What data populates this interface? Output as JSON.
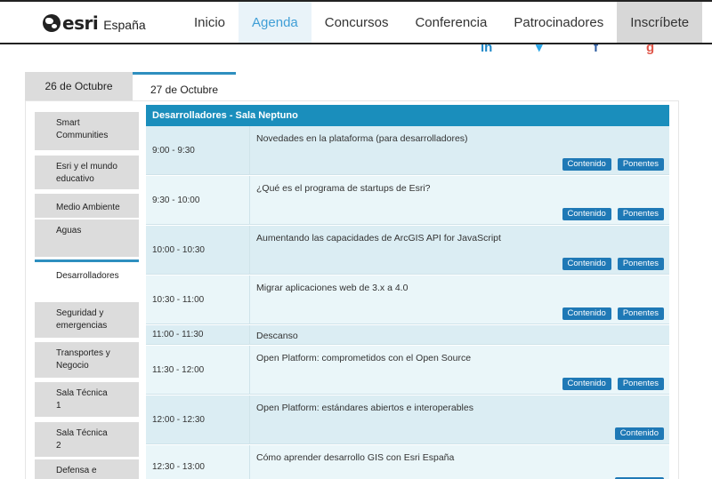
{
  "brand": {
    "name": "esri",
    "country": "España"
  },
  "nav": [
    {
      "label": "Inicio",
      "state": "normal"
    },
    {
      "label": "Agenda",
      "state": "active"
    },
    {
      "label": "Concursos",
      "state": "normal"
    },
    {
      "label": "Conferencia",
      "state": "normal"
    },
    {
      "label": "Patrocinadores",
      "state": "normal"
    },
    {
      "label": "Inscríbete",
      "state": "cta"
    }
  ],
  "social": [
    {
      "icon": "linkedin-icon",
      "glyph": "in",
      "color": "#1e88c8"
    },
    {
      "icon": "twitter-icon",
      "glyph": "▾",
      "color": "#2aa6e8"
    },
    {
      "icon": "facebook-icon",
      "glyph": "f",
      "color": "#2b5aa0"
    },
    {
      "icon": "google-plus-icon",
      "glyph": "g",
      "color": "#e0574a"
    }
  ],
  "days": [
    {
      "label": "26 de Octubre",
      "active": false
    },
    {
      "label": "27 de Octubre",
      "active": true
    }
  ],
  "rooms": [
    {
      "label": "Smart Communities",
      "active": false
    },
    {
      "label": "Esri y el mundo educativo",
      "active": false
    },
    {
      "label": "Medio Ambiente",
      "active": false
    },
    {
      "label": "Aguas",
      "active": false
    },
    {
      "label": "Desarrolladores",
      "active": true
    },
    {
      "label": "Seguridad y emergencias",
      "active": false
    },
    {
      "label": "Transportes y Negocio",
      "active": false
    },
    {
      "label": "Sala Técnica 1",
      "active": false
    },
    {
      "label": "Sala Técnica 2",
      "active": false
    },
    {
      "label": "Defensa e",
      "active": false
    }
  ],
  "schedule": {
    "heading": "Desarrolladores - Sala Neptuno",
    "buttons": {
      "content": "Contenido",
      "speakers": "Ponentes"
    },
    "sessions": [
      {
        "time": "9:00 - 9:30",
        "title": "Novedades en la plataforma (para desarrolladores)",
        "actions": [
          "Contenido",
          "Ponentes"
        ]
      },
      {
        "time": "9:30 - 10:00",
        "title": "¿Qué es el programa de startups de Esri?",
        "actions": [
          "Contenido",
          "Ponentes"
        ]
      },
      {
        "time": "10:00 - 10:30",
        "title": "Aumentando las capacidades de ArcGIS API for JavaScript",
        "actions": [
          "Contenido",
          "Ponentes"
        ]
      },
      {
        "time": "10:30 - 11:00",
        "title": "Migrar aplicaciones web de 3.x a 4.0",
        "actions": [
          "Contenido",
          "Ponentes"
        ]
      },
      {
        "time": "11:00 - 11:30",
        "title": "Descanso",
        "actions": []
      },
      {
        "time": "11:30 - 12:00",
        "title": "Open Platform: comprometidos con el Open Source",
        "actions": [
          "Contenido",
          "Ponentes"
        ]
      },
      {
        "time": "12:00 - 12:30",
        "title": "Open Platform: estándares abiertos e interoperables",
        "actions": [
          "Contenido"
        ]
      },
      {
        "time": "12:30 - 13:00",
        "title": "Cómo aprender desarrollo GIS con Esri España",
        "actions": [
          "Contenido"
        ]
      }
    ]
  },
  "colors": {
    "accent": "#1a8ebc",
    "button": "#1f79b6",
    "row_dark": "#dbedf3",
    "row_light": "#eaf6f9"
  }
}
